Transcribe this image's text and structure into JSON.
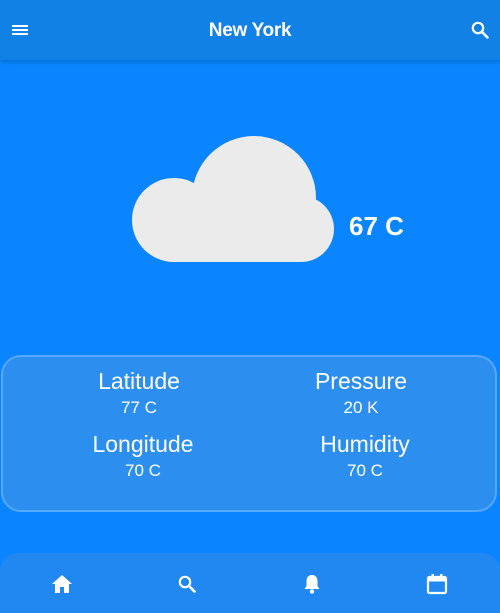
{
  "header": {
    "title": "New York",
    "menu_icon": "menu-icon",
    "search_icon": "search-icon"
  },
  "weather": {
    "condition_icon": "cloud-icon",
    "temperature": "67 C"
  },
  "details": [
    {
      "label": "Latitude",
      "value": "77 C"
    },
    {
      "label": "Pressure",
      "value": "20 K"
    },
    {
      "label": "Longitude",
      "value": "70 C"
    },
    {
      "label": "Humidity",
      "value": "70 C"
    }
  ],
  "bottom_nav": {
    "items": [
      {
        "icon": "home-icon"
      },
      {
        "icon": "search-icon"
      },
      {
        "icon": "bell-icon"
      },
      {
        "icon": "calendar-icon"
      }
    ]
  },
  "colors": {
    "background": "#0a85ff",
    "appbar": "#1281e6",
    "card": "#2c8ff0",
    "card_border": "#58a7ff",
    "cloud": "#ebebeb",
    "text": "#ffffff"
  }
}
